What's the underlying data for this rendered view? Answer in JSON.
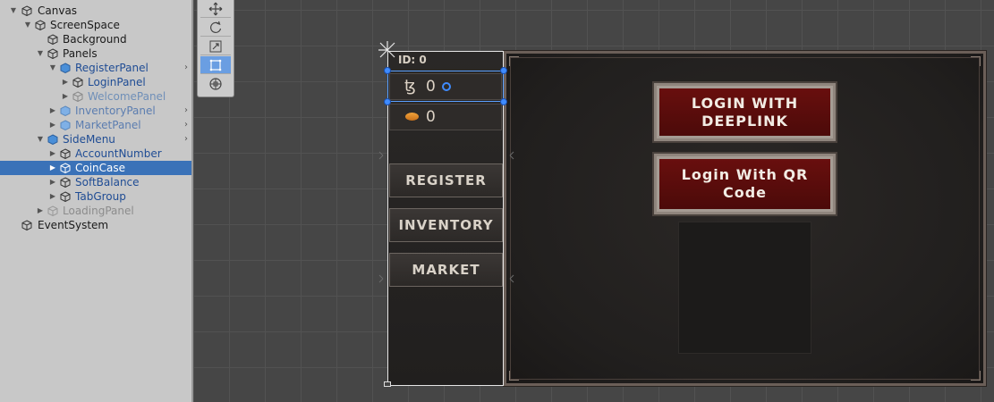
{
  "hierarchy": {
    "rows": [
      {
        "label": "Canvas"
      },
      {
        "label": "ScreenSpace"
      },
      {
        "label": "Background"
      },
      {
        "label": "Panels"
      },
      {
        "label": "RegisterPanel"
      },
      {
        "label": "LoginPanel"
      },
      {
        "label": "WelcomePanel"
      },
      {
        "label": "InventoryPanel"
      },
      {
        "label": "MarketPanel"
      },
      {
        "label": "SideMenu"
      },
      {
        "label": "AccountNumber"
      },
      {
        "label": "CoinCase"
      },
      {
        "label": "SoftBalance"
      },
      {
        "label": "TabGroup"
      },
      {
        "label": "LoadingPanel"
      },
      {
        "label": "EventSystem"
      }
    ],
    "selected": "CoinCase"
  },
  "tools": [
    "move-tool-icon",
    "rotate-tool-icon",
    "scale-tool-icon",
    "rect-tool-icon",
    "transform-tool-icon"
  ],
  "active_tool": "rect-tool-icon",
  "game_ui": {
    "id_label": "ID: 0",
    "tezos_balance": "0",
    "coin_balance": "0",
    "menu": [
      "REGISTER",
      "INVENTORY",
      "MARKET"
    ],
    "login_deeplink": "LOGIN WITH DEEPLINK",
    "login_qr": "Login With QR Code"
  },
  "colors": {
    "selection": "#3a72b8",
    "button_red": "#5a0c0b",
    "gizmo_handle": "#3f8cff"
  }
}
